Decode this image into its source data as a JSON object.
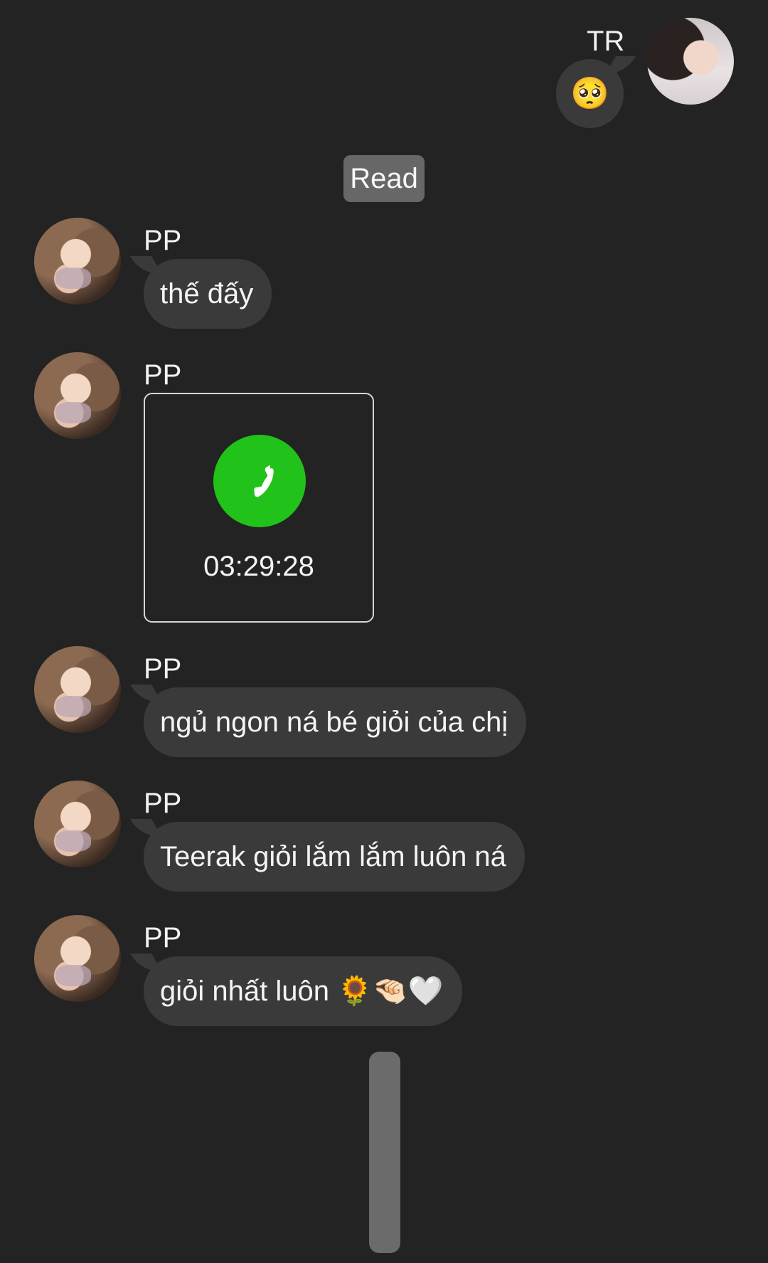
{
  "outgoing": {
    "sender_name": "TR",
    "message": "🥺"
  },
  "status": {
    "read_label": "Read"
  },
  "incoming": {
    "sender_name": "PP",
    "messages": [
      {
        "type": "text",
        "text": "thế đấy"
      },
      {
        "type": "call",
        "duration": "03:29:28",
        "icon": "phone-icon",
        "icon_color": "#21c21a"
      },
      {
        "type": "text",
        "text": "ngủ ngon ná bé giỏi của chị"
      },
      {
        "type": "text",
        "text": "Teerak giỏi lắm lắm luôn ná"
      },
      {
        "type": "text",
        "text": "giỏi nhất luôn 🌻🤏🏻🤍"
      }
    ]
  },
  "colors": {
    "background": "#232323",
    "bubble": "#3a3a3a",
    "read_badge": "#676767",
    "call_green": "#21c21a"
  }
}
